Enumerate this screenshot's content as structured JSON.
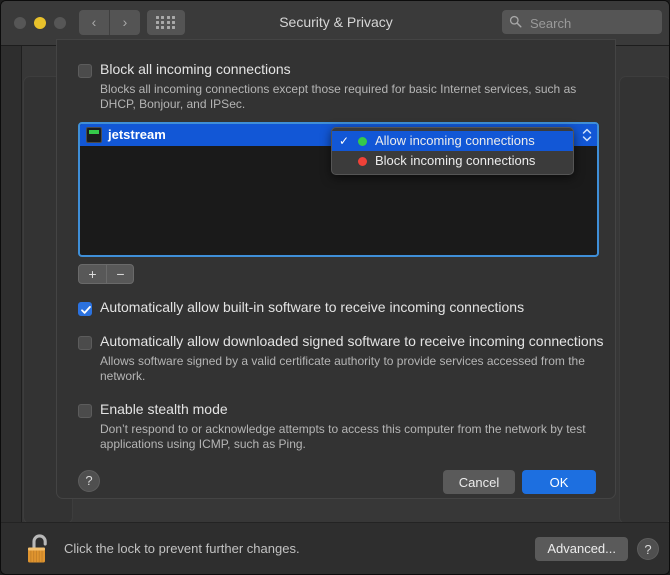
{
  "window": {
    "title": "Security & Privacy",
    "traffic_lights": [
      {
        "name": "close",
        "color": "#565656"
      },
      {
        "name": "minimize",
        "color": "#e8c12b"
      },
      {
        "name": "zoom",
        "color": "#565656"
      }
    ],
    "nav_back": "‹",
    "nav_forward": "›",
    "grid_button_name": "show-all-preferences"
  },
  "search": {
    "placeholder": "Search",
    "value": ""
  },
  "sheet": {
    "block_all": {
      "label": "Block all incoming connections",
      "checked": false,
      "description": "Blocks all incoming connections except those required for basic Internet services, such as DHCP, Bonjour, and IPSec."
    },
    "app_list": {
      "items": [
        {
          "name": "jetstream",
          "selected": true,
          "icon": "terminal-icon"
        }
      ],
      "add_label": "+",
      "remove_label": "−"
    },
    "popup_menu": {
      "options": [
        {
          "label": "Allow incoming connections",
          "dot_color": "#35c94a",
          "checked": true,
          "selected": true
        },
        {
          "label": "Block incoming connections",
          "dot_color": "#ef4138",
          "checked": false,
          "selected": false
        }
      ],
      "checkmark": "✓"
    },
    "auto_builtin": {
      "label": "Automatically allow built-in software to receive incoming connections",
      "checked": true
    },
    "auto_signed": {
      "label": "Automatically allow downloaded signed software to receive incoming connections",
      "checked": false,
      "description": "Allows software signed by a valid certificate authority to provide services accessed from the network."
    },
    "stealth": {
      "label": "Enable stealth mode",
      "checked": false,
      "description": "Don’t respond to or acknowledge attempts to access this computer from the network by test applications using ICMP, such as Ping."
    },
    "help_label": "?",
    "cancel_label": "Cancel",
    "ok_label": "OK"
  },
  "bottom_bar": {
    "lock_state": "unlocked",
    "lock_text": "Click the lock to prevent further changes.",
    "advanced_label": "Advanced...",
    "help_label": "?"
  },
  "colors": {
    "accent_blue": "#1d6fe0",
    "selection_blue": "#1257d6",
    "focus_ring": "#3f8fd8",
    "allow_green": "#35c94a",
    "block_red": "#ef4138",
    "lock_gold": "#e9a63a"
  }
}
